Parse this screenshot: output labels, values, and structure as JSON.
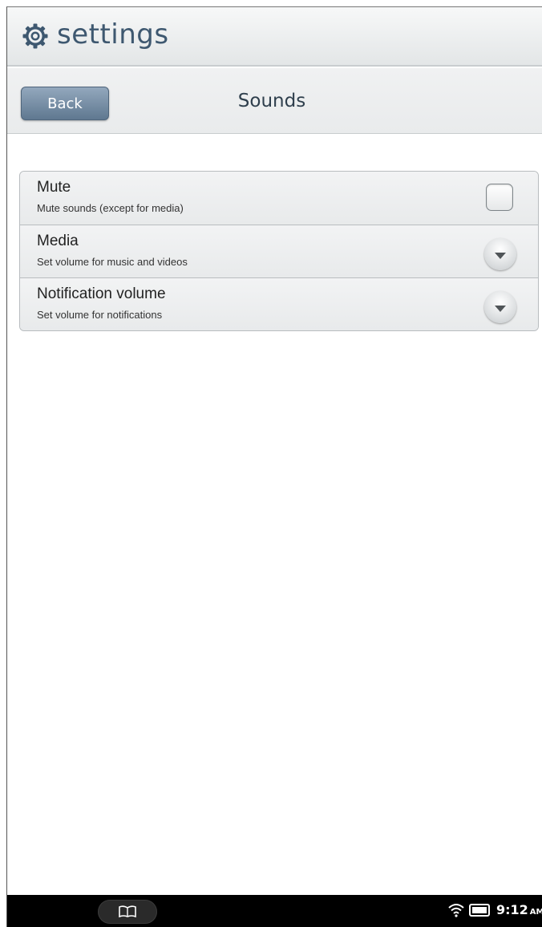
{
  "app": {
    "title": "settings",
    "icon": "gear-icon"
  },
  "nav": {
    "back_label": "Back",
    "title": "Sounds"
  },
  "settings": {
    "items": [
      {
        "title": "Mute",
        "subtitle": "Mute sounds (except for media)",
        "control": "checkbox",
        "checked": false
      },
      {
        "title": "Media",
        "subtitle": "Set volume for music and videos",
        "control": "dropdown"
      },
      {
        "title": "Notification volume",
        "subtitle": "Set volume for notifications",
        "control": "dropdown"
      }
    ]
  },
  "status_bar": {
    "time": "9:12",
    "ampm": "AM",
    "library_icon": "book-icon",
    "wifi_icon": "wifi-icon",
    "battery_icon": "battery-icon"
  },
  "colors": {
    "accent": "#3e5870",
    "back_button": "#6f87a0",
    "status_bar": "#000000"
  }
}
